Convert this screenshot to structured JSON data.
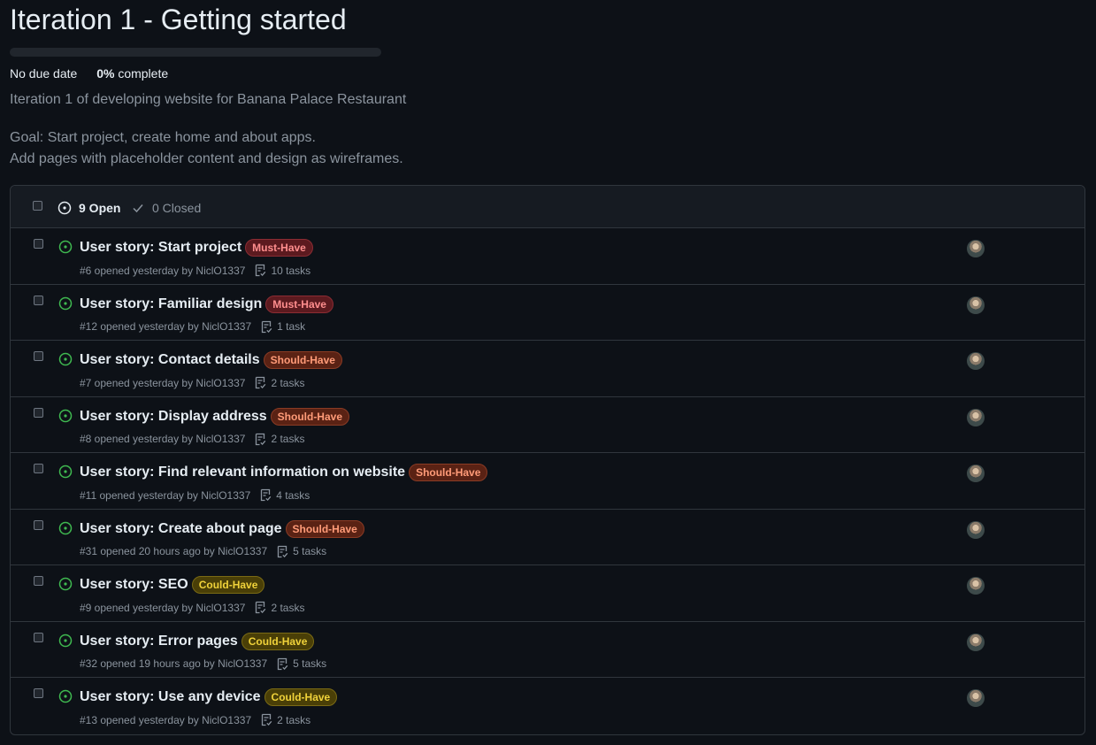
{
  "milestone": {
    "title": "Iteration 1 - Getting started",
    "progress": 0,
    "due": "No due date",
    "percent_complete": "0%",
    "complete_word": "complete",
    "description": "Iteration 1 of developing website for Banana Palace Restaurant",
    "goal_lines": [
      "Goal: Start project, create home and about apps.",
      "Add pages with placeholder content and design as wireframes."
    ]
  },
  "header": {
    "open_label": "9 Open",
    "closed_label": "0 Closed"
  },
  "colors": {
    "open_icon": "#3fb950",
    "progress": "#238636",
    "background": "#0d1117"
  },
  "issues": [
    {
      "title": "User story: Start project",
      "label": "Must-Have",
      "label_kind": "must",
      "meta": "#6 opened yesterday by NiclO1337",
      "tasks": "10 tasks"
    },
    {
      "title": "User story: Familiar design",
      "label": "Must-Have",
      "label_kind": "must",
      "meta": "#12 opened yesterday by NiclO1337",
      "tasks": "1 task"
    },
    {
      "title": "User story: Contact details",
      "label": "Should-Have",
      "label_kind": "should",
      "meta": "#7 opened yesterday by NiclO1337",
      "tasks": "2 tasks"
    },
    {
      "title": "User story: Display address",
      "label": "Should-Have",
      "label_kind": "should",
      "meta": "#8 opened yesterday by NiclO1337",
      "tasks": "2 tasks"
    },
    {
      "title": "User story: Find relevant information on website",
      "label": "Should-Have",
      "label_kind": "should",
      "meta": "#11 opened yesterday by NiclO1337",
      "tasks": "4 tasks"
    },
    {
      "title": "User story: Create about page",
      "label": "Should-Have",
      "label_kind": "should",
      "meta": "#31 opened 20 hours ago by NiclO1337",
      "tasks": "5 tasks"
    },
    {
      "title": "User story: SEO",
      "label": "Could-Have",
      "label_kind": "could",
      "meta": "#9 opened yesterday by NiclO1337",
      "tasks": "2 tasks"
    },
    {
      "title": "User story: Error pages",
      "label": "Could-Have",
      "label_kind": "could",
      "meta": "#32 opened 19 hours ago by NiclO1337",
      "tasks": "5 tasks"
    },
    {
      "title": "User story: Use any device",
      "label": "Could-Have",
      "label_kind": "could",
      "meta": "#13 opened yesterday by NiclO1337",
      "tasks": "2 tasks"
    }
  ]
}
